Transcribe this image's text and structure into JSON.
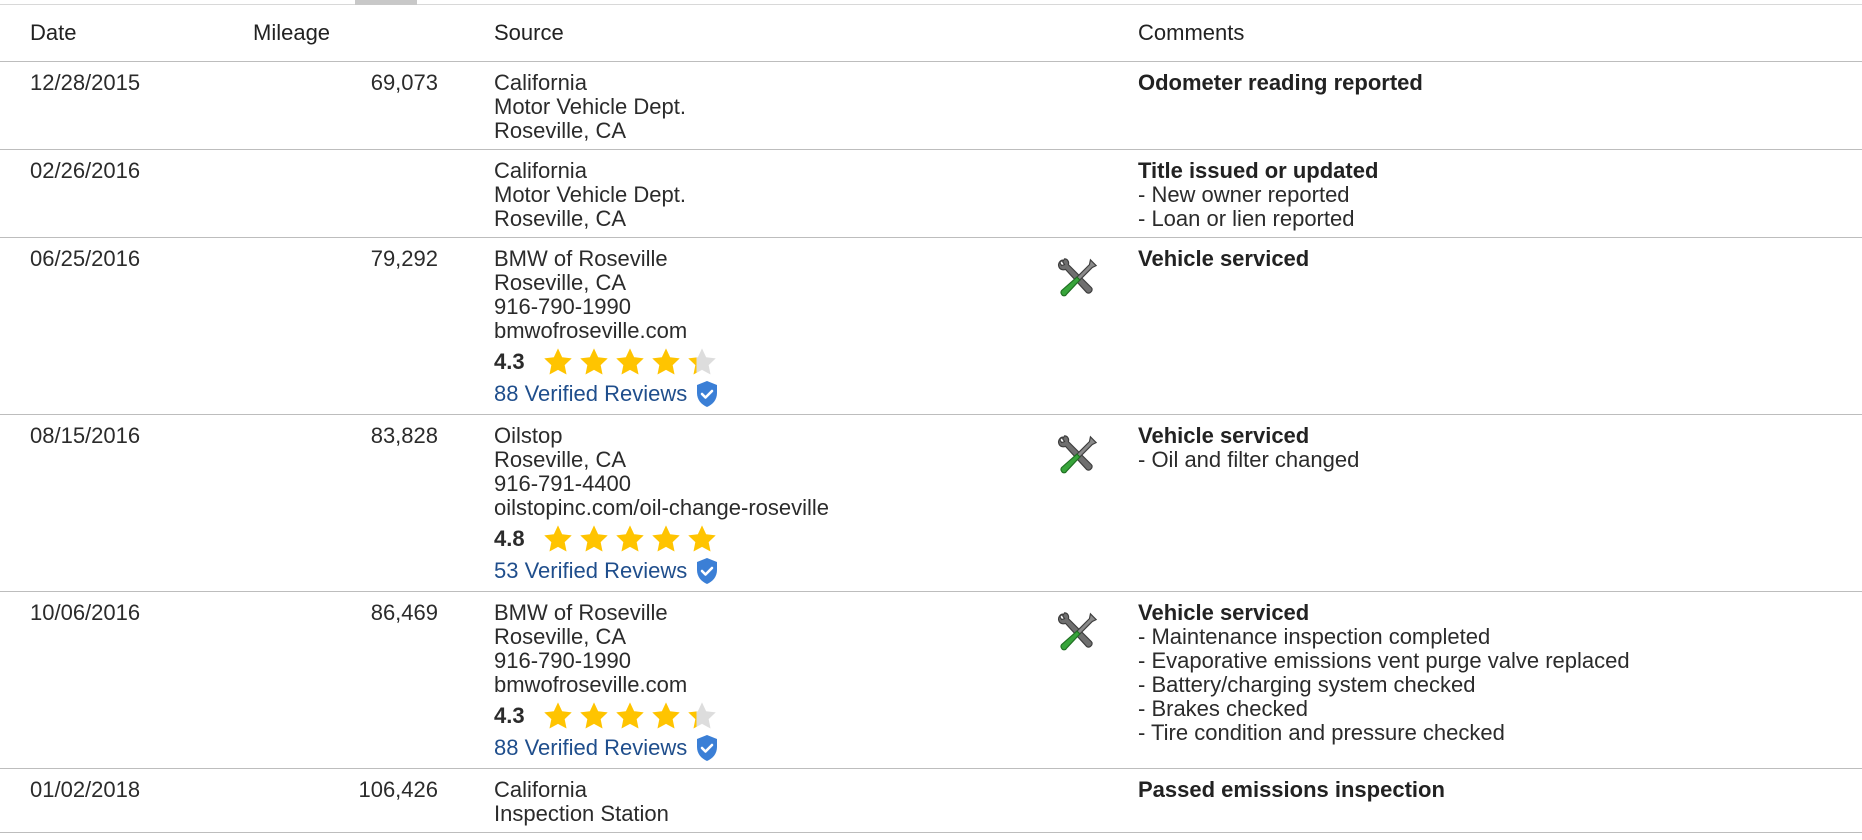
{
  "columns": {
    "date": "Date",
    "mileage": "Mileage",
    "source": "Source",
    "comments": "Comments"
  },
  "rows": [
    {
      "date": "12/28/2015",
      "mileage": "69,073",
      "source": [
        "California",
        "Motor Vehicle Dept.",
        "Roseville, CA"
      ],
      "comment_title": "Odometer reading reported",
      "comment_items": []
    },
    {
      "date": "02/26/2016",
      "mileage": "",
      "source": [
        "California",
        "Motor Vehicle Dept.",
        "Roseville, CA"
      ],
      "comment_title": "Title issued or updated",
      "comment_items": [
        "- New owner reported",
        "- Loan or lien reported"
      ]
    },
    {
      "date": "06/25/2016",
      "mileage": "79,292",
      "source": [
        "BMW of Roseville",
        "Roseville, CA",
        "916-790-1990",
        "bmwofroseville.com"
      ],
      "rating": "4.3",
      "stars": 4.3,
      "reviews": "88 Verified Reviews",
      "service_icon": "wrench-screwdriver-icon",
      "comment_title": "Vehicle serviced",
      "comment_items": []
    },
    {
      "date": "08/15/2016",
      "mileage": "83,828",
      "source": [
        "Oilstop",
        "Roseville, CA",
        "916-791-4400",
        "oilstopinc.com/oil-change-roseville"
      ],
      "rating": "4.8",
      "stars": 4.8,
      "reviews": "53 Verified Reviews",
      "service_icon": "wrench-screwdriver-icon",
      "comment_title": "Vehicle serviced",
      "comment_items": [
        "- Oil and filter changed"
      ]
    },
    {
      "date": "10/06/2016",
      "mileage": "86,469",
      "source": [
        "BMW of Roseville",
        "Roseville, CA",
        "916-790-1990",
        "bmwofroseville.com"
      ],
      "rating": "4.3",
      "stars": 4.3,
      "reviews": "88 Verified Reviews",
      "service_icon": "wrench-screwdriver-icon",
      "comment_title": "Vehicle serviced",
      "comment_items": [
        "- Maintenance inspection completed",
        "- Evaporative emissions vent purge valve replaced",
        "- Battery/charging system checked",
        "- Brakes checked",
        "- Tire condition and pressure checked"
      ]
    },
    {
      "date": "01/02/2018",
      "mileage": "106,426",
      "source": [
        "California",
        "Inspection Station"
      ],
      "comment_title": "Passed emissions inspection",
      "comment_items": []
    }
  ],
  "colors": {
    "star": "#FFC400",
    "star_empty": "#dddddd",
    "review_link": "#1f4e8c",
    "shield": "#3b7fd6",
    "divider": "#bdbdbd"
  }
}
